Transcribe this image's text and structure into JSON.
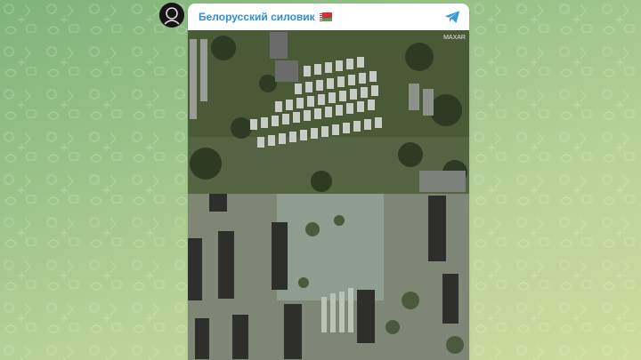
{
  "post": {
    "channel_name": "Белорусский силовик",
    "flag": "belarus-flag",
    "share_icon": "telegram-send-icon",
    "watermark": "MAXAR"
  },
  "colors": {
    "channel_name": "#2f8fd0",
    "share_icon": "#3a9ad9",
    "background": "#9cc48a"
  }
}
